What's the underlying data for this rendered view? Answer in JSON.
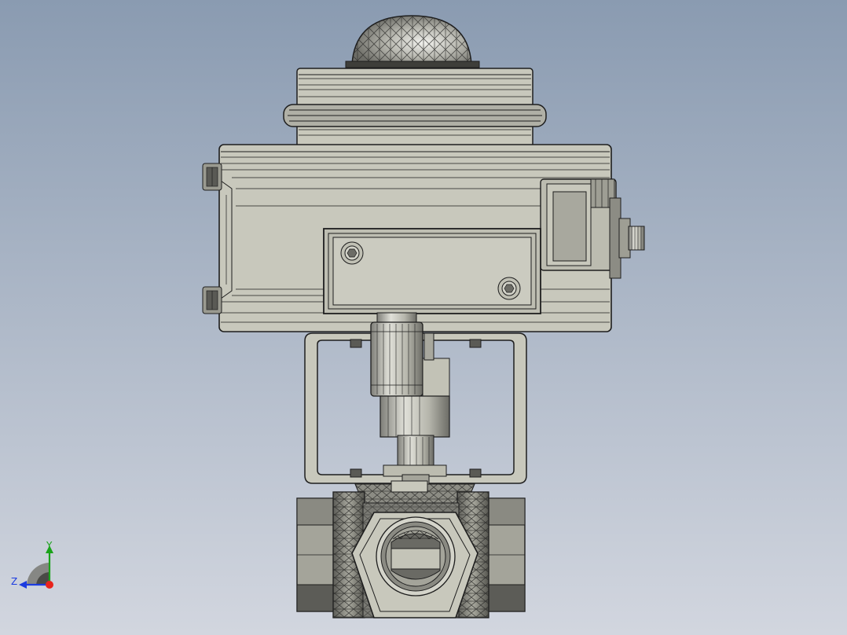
{
  "view": {
    "background_top": "#8a9bb1",
    "background_bottom": "#d2d6df"
  },
  "model": {
    "body_fill": "#c8c8bc",
    "body_light": "#d9d9cf",
    "body_dark": "#a4a49a",
    "outline": "#1e1e1e",
    "dark_fill": "#5a5a55"
  },
  "triad": {
    "x_color": "#e8231c",
    "y_color": "#1aa31a",
    "z_color": "#1c3ce0",
    "y_label": "Y",
    "z_label": "Z"
  }
}
